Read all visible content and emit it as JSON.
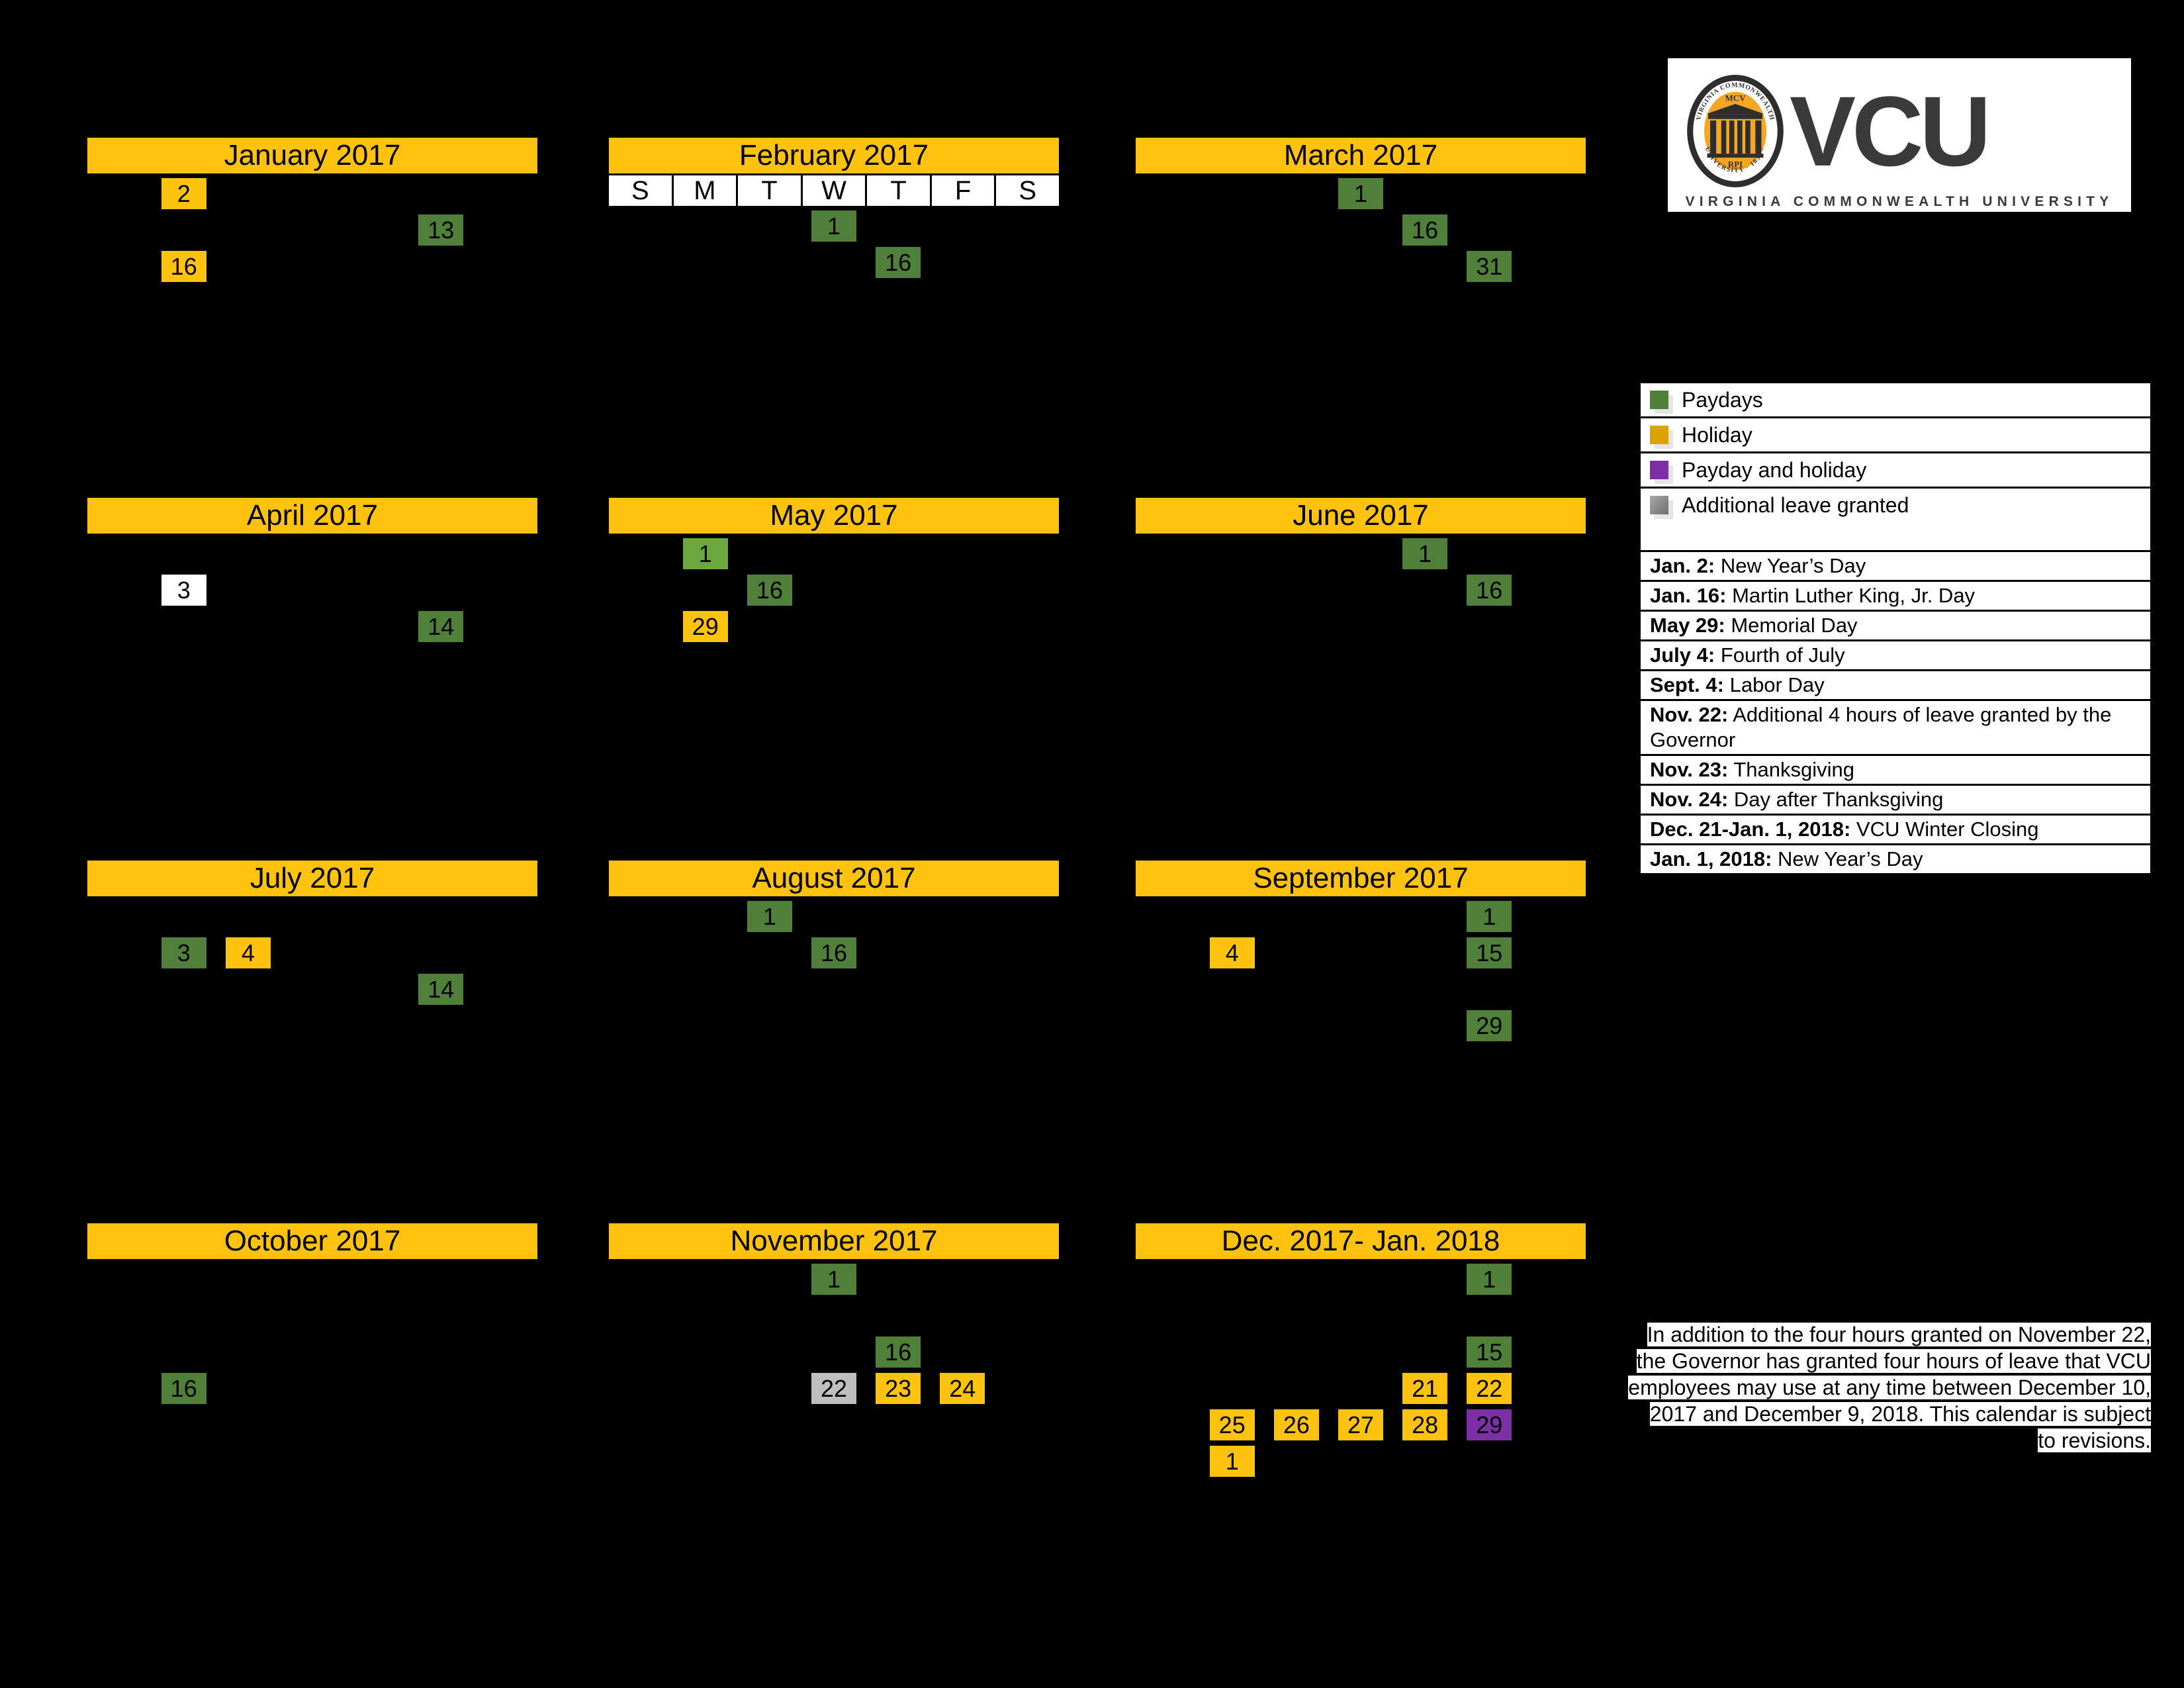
{
  "logo": {
    "wordmark": "VCU",
    "tagline": "VIRGINIA COMMONWEALTH UNIVERSITY",
    "seal": {
      "ring_text": "VIRGINIA COMMONWEALTH UNIVERSITY",
      "top_label": "MCV",
      "bottom_label": "RPI",
      "year": "1838"
    },
    "colors": {
      "gold": "#F5A623",
      "dark": "#3A3A3A"
    }
  },
  "colors": {
    "payday": "#4F7F38",
    "holiday": "#FFC20E",
    "payday_and_holiday": "#7D2FA8",
    "additional_leave": "#BFBFBF",
    "header_bar": "#FFC20E",
    "background": "#000000"
  },
  "dow_header": [
    "S",
    "M",
    "T",
    "W",
    "T",
    "F",
    "S"
  ],
  "months": [
    {
      "title": "January 2017",
      "show_dow": false,
      "days": [
        {
          "n": "2",
          "col": 2,
          "row": 1,
          "kind": "hol"
        },
        {
          "n": "13",
          "col": 6,
          "row": 2,
          "kind": "pay"
        },
        {
          "n": "16",
          "col": 2,
          "row": 3,
          "kind": "hol"
        }
      ]
    },
    {
      "title": "February 2017",
      "show_dow": true,
      "days": [
        {
          "n": "1",
          "col": 4,
          "row": 1,
          "kind": "pay"
        },
        {
          "n": "16",
          "col": 5,
          "row": 2,
          "kind": "pay"
        }
      ]
    },
    {
      "title": "March 2017",
      "show_dow": false,
      "days": [
        {
          "n": "1",
          "col": 4,
          "row": 1,
          "kind": "pay"
        },
        {
          "n": "16",
          "col": 5,
          "row": 2,
          "kind": "pay"
        },
        {
          "n": "31",
          "col": 6,
          "row": 3,
          "kind": "pay"
        }
      ]
    },
    {
      "title": "April 2017",
      "show_dow": false,
      "days": [
        {
          "n": "3",
          "col": 2,
          "row": 2,
          "kind": "plain"
        },
        {
          "n": "14",
          "col": 6,
          "row": 3,
          "kind": "pay"
        }
      ]
    },
    {
      "title": "May 2017",
      "show_dow": false,
      "days": [
        {
          "n": "1",
          "col": 2,
          "row": 1,
          "kind": "pay2"
        },
        {
          "n": "16",
          "col": 3,
          "row": 2,
          "kind": "pay"
        },
        {
          "n": "29",
          "col": 2,
          "row": 3,
          "kind": "hol"
        }
      ]
    },
    {
      "title": "June 2017",
      "show_dow": false,
      "days": [
        {
          "n": "1",
          "col": 5,
          "row": 1,
          "kind": "pay"
        },
        {
          "n": "16",
          "col": 6,
          "row": 2,
          "kind": "pay"
        }
      ]
    },
    {
      "title": "July 2017",
      "show_dow": false,
      "days": [
        {
          "n": "3",
          "col": 2,
          "row": 2,
          "kind": "pay"
        },
        {
          "n": "4",
          "col": 3,
          "row": 2,
          "kind": "hol"
        },
        {
          "n": "14",
          "col": 6,
          "row": 3,
          "kind": "pay"
        }
      ]
    },
    {
      "title": "August 2017",
      "show_dow": false,
      "days": [
        {
          "n": "1",
          "col": 3,
          "row": 1,
          "kind": "pay"
        },
        {
          "n": "16",
          "col": 4,
          "row": 2,
          "kind": "pay"
        }
      ]
    },
    {
      "title": "September 2017",
      "show_dow": false,
      "days": [
        {
          "n": "1",
          "col": 6,
          "row": 1,
          "kind": "pay"
        },
        {
          "n": "4",
          "col": 2,
          "row": 2,
          "kind": "hol"
        },
        {
          "n": "15",
          "col": 6,
          "row": 2,
          "kind": "pay"
        },
        {
          "n": "29",
          "col": 6,
          "row": 4,
          "kind": "pay"
        }
      ]
    },
    {
      "title": "October 2017",
      "show_dow": false,
      "days": [
        {
          "n": "16",
          "col": 2,
          "row": 4,
          "kind": "pay"
        }
      ]
    },
    {
      "title": "November 2017",
      "show_dow": false,
      "days": [
        {
          "n": "1",
          "col": 4,
          "row": 1,
          "kind": "pay"
        },
        {
          "n": "16",
          "col": 5,
          "row": 3,
          "kind": "pay"
        },
        {
          "n": "22",
          "col": 4,
          "row": 4,
          "kind": "leave"
        },
        {
          "n": "23",
          "col": 5,
          "row": 4,
          "kind": "hol"
        },
        {
          "n": "24",
          "col": 6,
          "row": 4,
          "kind": "hol"
        }
      ]
    },
    {
      "title": "Dec. 2017- Jan. 2018",
      "show_dow": false,
      "days": [
        {
          "n": "1",
          "col": 6,
          "row": 1,
          "kind": "pay"
        },
        {
          "n": "15",
          "col": 6,
          "row": 3,
          "kind": "pay"
        },
        {
          "n": "21",
          "col": 5,
          "row": 4,
          "kind": "hol"
        },
        {
          "n": "22",
          "col": 6,
          "row": 4,
          "kind": "hol"
        },
        {
          "n": "25",
          "col": 2,
          "row": 5,
          "kind": "hol"
        },
        {
          "n": "26",
          "col": 3,
          "row": 5,
          "kind": "hol"
        },
        {
          "n": "27",
          "col": 4,
          "row": 5,
          "kind": "hol"
        },
        {
          "n": "28",
          "col": 5,
          "row": 5,
          "kind": "hol"
        },
        {
          "n": "29",
          "col": 6,
          "row": 5,
          "kind": "both"
        },
        {
          "n": "1",
          "col": 2,
          "row": 6,
          "kind": "hol"
        }
      ]
    }
  ],
  "legend": {
    "swatches": [
      {
        "key": "g",
        "label": "Paydays"
      },
      {
        "key": "y",
        "label": "Holiday"
      },
      {
        "key": "p",
        "label": "Payday and holiday"
      },
      {
        "key": "a",
        "label": "Additional leave granted"
      }
    ],
    "holidays": [
      {
        "date": "Jan. 2:",
        "name": " New Year’s Day"
      },
      {
        "date": "Jan. 16:",
        "name": " Martin Luther King, Jr. Day"
      },
      {
        "date": "May 29:",
        "name": " Memorial Day"
      },
      {
        "date": "July 4:",
        "name": " Fourth of July"
      },
      {
        "date": "Sept. 4:",
        "name": " Labor Day"
      },
      {
        "date": "Nov. 22:",
        "name": " Additional 4 hours of leave granted by the Governor"
      },
      {
        "date": "Nov. 23:",
        "name": " Thanksgiving"
      },
      {
        "date": "Nov. 24:",
        "name": " Day after Thanksgiving"
      },
      {
        "date": "Dec. 21-Jan. 1, 2018:",
        "name": " VCU Winter Closing"
      },
      {
        "date": "Jan. 1, 2018:",
        "name": " New Year’s Day"
      }
    ]
  },
  "footnote": "In addition to the four hours granted on November 22, the Governor has granted four hours of leave that VCU employees may use at any time between December 10, 2017 and December 9, 2018. This calendar is subject to revisions."
}
